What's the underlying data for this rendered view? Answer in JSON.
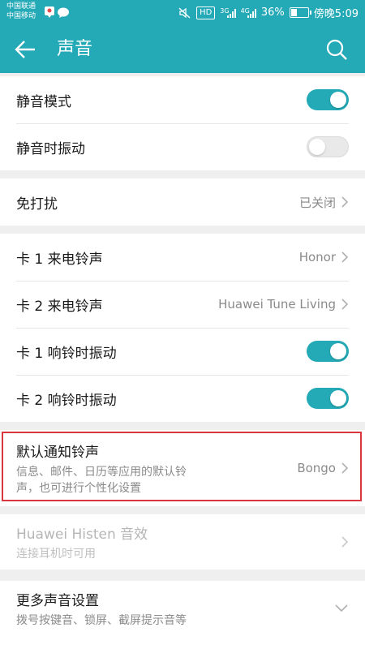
{
  "status_bar": {
    "carrier_1": "中国联通",
    "carrier_2": "中国移动",
    "hd_badge": "HD",
    "network_1": "3G",
    "network_2": "4G",
    "battery": "36%",
    "battery_level": 0.36,
    "time": "傍晚5:09"
  },
  "app_bar": {
    "title": "声音"
  },
  "settings": {
    "silent_mode": {
      "label": "静音模式",
      "enabled": true
    },
    "silent_vibrate": {
      "label": "静音时振动",
      "enabled": false
    },
    "dnd": {
      "label": "免打扰",
      "value": "已关闭"
    },
    "sim1_ringtone": {
      "label": "卡 1 来电铃声",
      "value": "Honor"
    },
    "sim2_ringtone": {
      "label": "卡 2 来电铃声",
      "value": "Huawei Tune Living"
    },
    "sim1_vibrate": {
      "label": "卡 1 响铃时振动",
      "enabled": true
    },
    "sim2_vibrate": {
      "label": "卡 2 响铃时振动",
      "enabled": true
    },
    "notification_tone": {
      "label": "默认通知铃声",
      "description_line_1": "信息、邮件、日历等应用的默认铃",
      "description_line_2": "声，也可进行个性化设置",
      "value": "Bongo"
    },
    "histen": {
      "label": "Huawei Histen 音效",
      "description": "连接耳机时可用"
    },
    "more_sound": {
      "label": "更多声音设置",
      "description": "拨号按键音、锁屏、截屏提示音等"
    }
  },
  "colors": {
    "accent": "#24a9b6",
    "highlight_border": "#d9363e"
  },
  "icons": {
    "back": "arrow-left",
    "search": "magnifier",
    "chevron": "chevron-right",
    "expand": "chevron-down"
  }
}
